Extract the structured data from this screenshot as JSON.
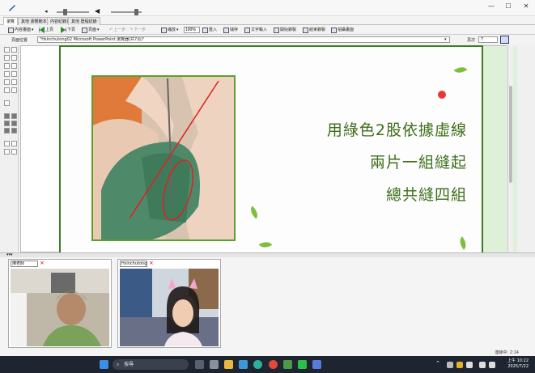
{
  "window": {
    "minimize": "—",
    "maximize": "☐",
    "close": "✕"
  },
  "tabs": [
    "瀏覽",
    "其他 瀏覽範本",
    "內容紀錄頁",
    "其他 歷程紀錄"
  ],
  "toolbar": {
    "view": "內容畫面",
    "prev": "上頁",
    "next": "下頁",
    "pages": "頁面",
    "back": "上一步",
    "forward": "下一步",
    "zoom": "縮放",
    "zoom_value": "100%",
    "import": "匯入",
    "save": "儲存",
    "textbox": "文字輸入",
    "rec_start": "開始錄製",
    "rec_stop": "結束錄製",
    "snapshot": "拍攝畫面"
  },
  "address": {
    "label": "頁面位置",
    "value": "\"Hsinchutong02 Microsoft PowerPoint 瀏覽器(共7頁)\"",
    "page_label": "頁次",
    "page_value": "7"
  },
  "slide": {
    "line1": "用綠色2股依據虛線",
    "line2": "兩片一組縫起",
    "line3": "總共縫四組"
  },
  "video": {
    "tile1_name": "陳老師",
    "tile2_name": "Hsinchutong02"
  },
  "status": "連線中: 2:14",
  "taskbar": {
    "search": "搜尋",
    "time": "上午 10:22",
    "date": "2025/7/22"
  },
  "colors": {
    "slide_text": "#3d6e19",
    "slide_border": "#3a7d22",
    "leaf": "#7cbf3d",
    "taskbar": "#1f2530"
  }
}
